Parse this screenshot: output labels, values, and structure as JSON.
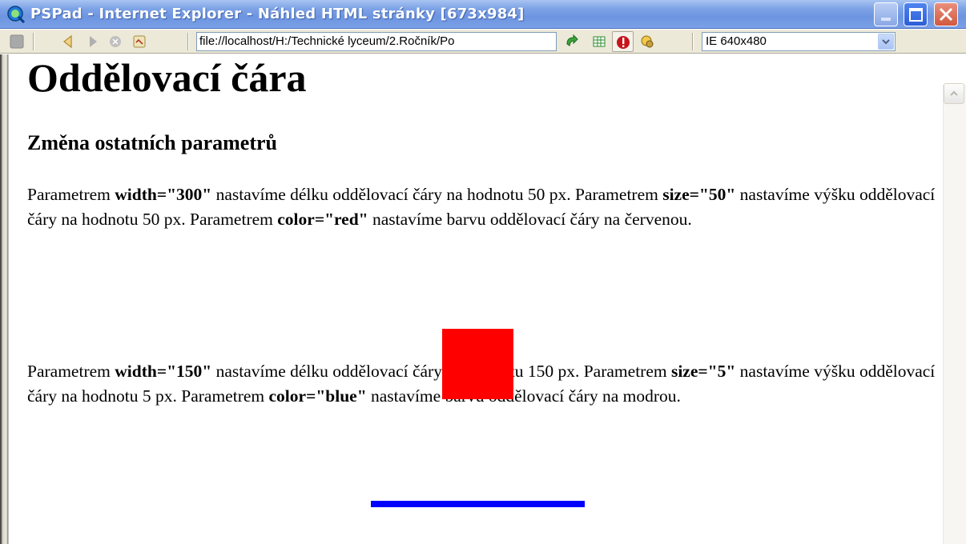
{
  "window": {
    "title": "PSPad - Internet Explorer - Náhled HTML stránky   [673x984]",
    "controls": [
      "minimize",
      "maximize",
      "close"
    ]
  },
  "toolbar": {
    "address": "file://localhost/H:/Technické lyceum/2.Ročník/Po",
    "resolution_selected": "IE 640x480"
  },
  "page": {
    "heading": "Oddělovací čára",
    "subheading": "Změna ostatních parametrů",
    "p1": {
      "t1": "Parametrem ",
      "b1": "width=\"300\"",
      "t2": " nastavíme délku oddělovací čáry na hodnotu 50 px. Parametrem ",
      "b2": "size=\"50\"",
      "t3": " nastavíme výšku oddělovací čáry na hodnotu 50 px. Parametrem ",
      "b3": "color=\"red\"",
      "t4": " nastavíme barvu oddělovací čáry na červenou."
    },
    "p2": {
      "t1": "Parametrem ",
      "b1": "width=\"150\"",
      "t2": " nastavíme délku oddělovací čáry na hodnotu 150 px. Parametrem ",
      "b2": "size=\"5\"",
      "t3": " nastavíme výšku oddělovací čáry na hodnotu 5 px. Parametrem ",
      "b3": "color=\"blue\"",
      "t4": " nastavíme barvu oddělovací čáry na modrou."
    },
    "rule_colors": {
      "red": "#ff0000",
      "blue": "#0000ff"
    }
  },
  "icons": [
    "app-icon",
    "stop-icon",
    "back-icon",
    "forward-icon",
    "refresh-icon",
    "home-icon",
    "go-icon",
    "table-icon",
    "warning-icon",
    "settings-icon",
    "dropdown-arrow-icon",
    "scroll-up-icon"
  ]
}
